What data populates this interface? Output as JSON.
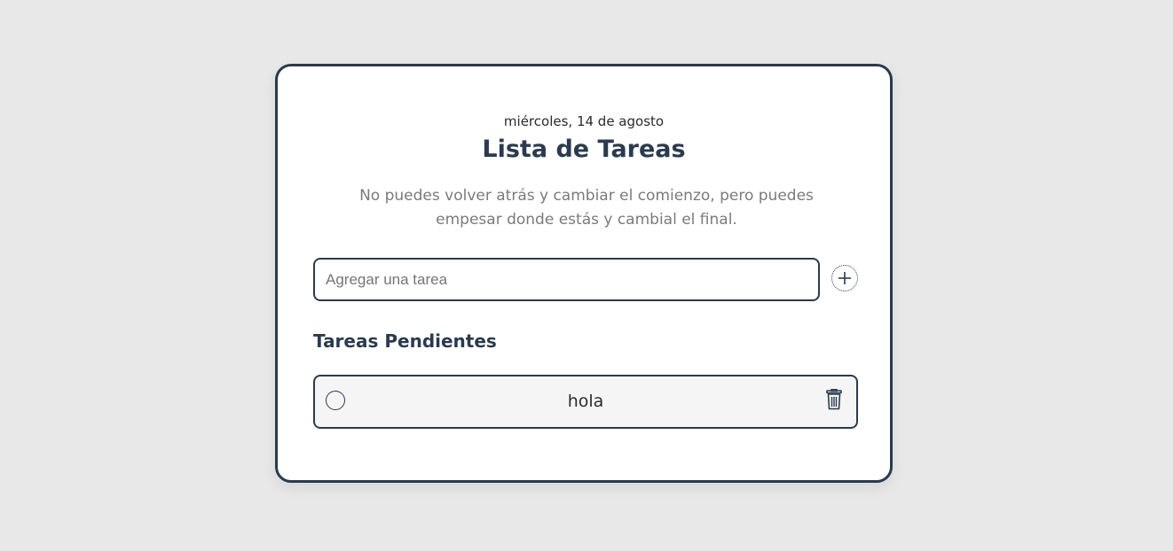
{
  "header": {
    "date": "miércoles, 14 de agosto",
    "title": "Lista de Tareas",
    "quote": "No puedes volver atrás y cambiar el comienzo, pero puedes empesar donde estás y cambial el final."
  },
  "new_task": {
    "placeholder": "Agregar una tarea",
    "value": "",
    "add_icon": "plus-circle-icon"
  },
  "pending": {
    "section_title": "Tareas Pendientes",
    "tasks": [
      {
        "text": "hola",
        "completed": false,
        "check_icon": "circle-icon",
        "delete_icon": "trash-icon"
      }
    ]
  },
  "colors": {
    "background": "#e8e8e8",
    "card": "#ffffff",
    "accent": "#2b3a4e",
    "muted_text": "#7a7a7a",
    "task_bg": "#f5f5f5"
  }
}
